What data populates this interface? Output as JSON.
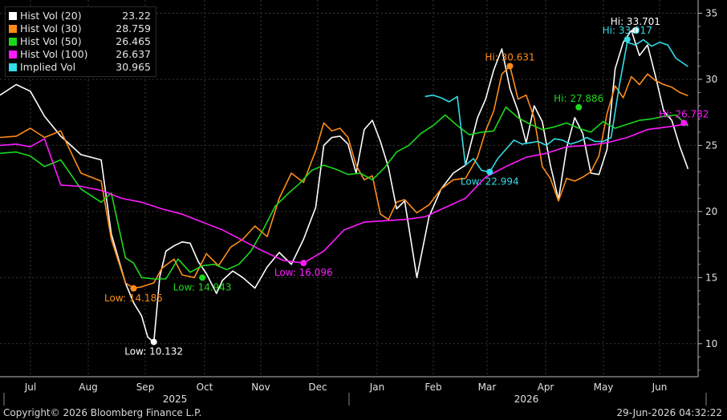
{
  "chart_data": {
    "type": "line",
    "xlabel": "",
    "ylabel": "",
    "ylim": [
      7.5,
      36
    ],
    "yticks": [
      10,
      15,
      20,
      25,
      30,
      35
    ],
    "grid": true,
    "legend_position": "top-left",
    "month_labels": [
      "Jul",
      "Aug",
      "Sep",
      "Oct",
      "Nov",
      "Dec",
      "Jan",
      "Feb",
      "Mar",
      "Apr",
      "May",
      "Jun"
    ],
    "year_labels": [
      "2025",
      "2026"
    ],
    "series": [
      {
        "name": "Hist Vol (20)",
        "last": "23.22",
        "color": "#ffffff",
        "x": [
          0,
          8,
          15,
          22,
          30,
          40,
          50,
          55,
          62,
          66,
          70,
          73,
          76,
          79,
          82,
          86,
          90,
          94,
          98,
          102,
          107,
          110,
          115,
          120,
          126,
          132,
          138,
          144,
          150,
          156,
          160,
          164,
          168,
          172,
          176,
          180,
          184,
          188,
          192,
          196,
          200,
          206,
          212,
          218,
          224,
          230,
          236,
          240,
          244,
          248,
          252,
          256,
          260,
          264,
          268,
          272,
          276,
          280,
          284,
          288,
          292,
          296,
          300,
          304,
          308,
          312,
          316,
          320,
          324,
          328,
          332,
          336,
          340
        ],
        "y": [
          28.8,
          29.6,
          29.1,
          27.2,
          25.7,
          24.3,
          23.9,
          18.3,
          14.6,
          13.1,
          12.1,
          10.5,
          10.1,
          15.1,
          17.0,
          17.4,
          17.7,
          17.6,
          16.2,
          15.3,
          13.8,
          14.8,
          15.5,
          15.0,
          14.2,
          15.8,
          16.9,
          16.0,
          17.9,
          20.3,
          25.0,
          25.6,
          25.7,
          25.1,
          22.9,
          26.2,
          26.9,
          25.3,
          23.3,
          20.2,
          20.8,
          15.0,
          19.6,
          21.7,
          22.9,
          23.5,
          27.1,
          28.5,
          30.7,
          32.3,
          29.3,
          27.6,
          25.2,
          28.0,
          26.8,
          23.5,
          20.9,
          24.8,
          27.1,
          25.9,
          22.9,
          22.8,
          24.7,
          30.8,
          32.8,
          33.7,
          31.8,
          32.6,
          30.2,
          27.6,
          26.9,
          24.9,
          23.22
        ]
      },
      {
        "name": "Hist Vol (30)",
        "last": "28.759",
        "color": "#ff8c1a",
        "x": [
          0,
          8,
          15,
          22,
          30,
          40,
          50,
          55,
          62,
          66,
          70,
          76,
          80,
          86,
          90,
          96,
          102,
          108,
          114,
          120,
          126,
          132,
          138,
          144,
          150,
          156,
          160,
          164,
          168,
          172,
          176,
          180,
          184,
          188,
          192,
          196,
          200,
          206,
          212,
          218,
          224,
          230,
          236,
          240,
          244,
          248,
          252,
          256,
          260,
          264,
          268,
          272,
          276,
          280,
          284,
          288,
          292,
          296,
          300,
          304,
          308,
          312,
          316,
          320,
          324,
          328,
          332,
          336,
          340
        ],
        "y": [
          25.6,
          25.7,
          26.3,
          25.6,
          26.1,
          22.9,
          22.3,
          17.9,
          14.6,
          14.2,
          14.3,
          14.6,
          15.7,
          16.4,
          15.2,
          15.0,
          16.8,
          15.9,
          17.3,
          17.9,
          18.9,
          18.1,
          21.0,
          22.9,
          22.2,
          24.6,
          26.7,
          26.1,
          26.3,
          25.6,
          23.5,
          22.4,
          22.7,
          19.8,
          19.4,
          20.7,
          20.9,
          19.9,
          20.5,
          21.7,
          22.4,
          22.5,
          24.1,
          26.1,
          27.6,
          30.4,
          31.0,
          28.5,
          28.8,
          27.1,
          23.4,
          22.5,
          20.8,
          22.5,
          22.3,
          22.6,
          23.0,
          24.2,
          27.4,
          29.5,
          28.6,
          30.2,
          29.6,
          30.4,
          29.9,
          29.6,
          29.4,
          29.0,
          28.759
        ]
      },
      {
        "name": "Hist Vol (50)",
        "last": "26.465",
        "color": "#1cd81c",
        "x": [
          0,
          8,
          15,
          22,
          30,
          40,
          50,
          55,
          62,
          66,
          70,
          76,
          82,
          88,
          94,
          100,
          106,
          112,
          118,
          124,
          130,
          136,
          142,
          148,
          154,
          160,
          166,
          172,
          178,
          184,
          190,
          196,
          202,
          208,
          214,
          220,
          226,
          232,
          238,
          244,
          250,
          256,
          262,
          268,
          274,
          280,
          286,
          292,
          298,
          304,
          310,
          316,
          322,
          328,
          334,
          340
        ],
        "y": [
          24.4,
          24.5,
          24.2,
          23.4,
          23.9,
          21.7,
          20.7,
          21.4,
          16.5,
          16.1,
          15.0,
          14.9,
          14.9,
          16.4,
          15.4,
          15.9,
          16.0,
          15.6,
          16.0,
          17.0,
          18.6,
          20.4,
          21.3,
          22.1,
          23.1,
          23.5,
          23.2,
          22.8,
          22.9,
          22.4,
          23.3,
          24.5,
          25.0,
          25.9,
          26.5,
          27.3,
          26.5,
          25.8,
          26.0,
          26.1,
          27.9,
          27.1,
          26.6,
          26.2,
          26.4,
          26.7,
          26.3,
          26.0,
          26.8,
          26.3,
          26.6,
          26.9,
          27.0,
          27.2,
          27.3,
          26.465
        ]
      },
      {
        "name": "Hist Vol (100)",
        "last": "26.637",
        "color": "#ff1cff",
        "x": [
          0,
          8,
          15,
          22,
          30,
          40,
          50,
          60,
          70,
          80,
          90,
          100,
          110,
          120,
          130,
          140,
          150,
          160,
          170,
          180,
          190,
          200,
          210,
          220,
          230,
          240,
          250,
          260,
          270,
          280,
          290,
          300,
          310,
          320,
          330,
          340
        ],
        "y": [
          25.0,
          25.1,
          24.9,
          25.5,
          22.0,
          21.9,
          21.6,
          21.0,
          20.7,
          20.2,
          19.8,
          19.2,
          18.6,
          17.8,
          17.0,
          16.3,
          16.1,
          17.0,
          18.6,
          19.2,
          19.3,
          19.4,
          19.6,
          20.3,
          21.0,
          22.6,
          23.4,
          24.1,
          24.4,
          24.9,
          25.0,
          25.2,
          25.6,
          26.2,
          26.4,
          26.637
        ]
      },
      {
        "name": "Implied Vol",
        "last": "30.965",
        "color": "#33dce8",
        "x": [
          210,
          214,
          218,
          222,
          226,
          230,
          234,
          238,
          242,
          246,
          250,
          254,
          258,
          262,
          266,
          270,
          274,
          278,
          282,
          286,
          290,
          294,
          298,
          302,
          306,
          310,
          314,
          318,
          322,
          326,
          330,
          334,
          340
        ],
        "y": [
          28.7,
          28.8,
          28.6,
          28.3,
          28.7,
          23.5,
          24.0,
          23.1,
          22.99,
          24.0,
          24.7,
          25.4,
          25.1,
          25.2,
          25.3,
          25.0,
          25.5,
          25.4,
          25.1,
          25.3,
          25.6,
          25.3,
          25.3,
          25.6,
          29.5,
          32.8,
          32.6,
          33.0,
          32.5,
          32.8,
          32.6,
          31.6,
          30.965
        ]
      }
    ],
    "annotations": [
      {
        "text": "Low: 10.132",
        "x": 76,
        "y": 10.132,
        "series": 0
      },
      {
        "text": "Hi: 33.701",
        "x": 314,
        "y": 33.701,
        "series": 0
      },
      {
        "text": "Low: 14.185",
        "x": 66,
        "y": 14.185,
        "series": 1
      },
      {
        "text": "Hi: 30.631",
        "x": 252,
        "y": 31.0,
        "series": 1
      },
      {
        "text": "Low: 14.943",
        "x": 100,
        "y": 15.0,
        "series": 2
      },
      {
        "text": "Hi: 27.886",
        "x": 286,
        "y": 27.886,
        "series": 2
      },
      {
        "text": "Low: 16.096",
        "x": 150,
        "y": 16.1,
        "series": 3
      },
      {
        "text": "Hi: 26.782",
        "x": 338,
        "y": 26.7,
        "series": 3
      },
      {
        "text": "Low: 22.994",
        "x": 242,
        "y": 22.994,
        "series": 4
      },
      {
        "text": "Hi: 33.017",
        "x": 310,
        "y": 33.017,
        "series": 4
      }
    ]
  },
  "legend": [
    {
      "name": "Hist Vol (20)",
      "value": "23.22",
      "color": "#ffffff"
    },
    {
      "name": "Hist Vol (30)",
      "value": "28.759",
      "color": "#ff8c1a"
    },
    {
      "name": "Hist Vol (50)",
      "value": "26.465",
      "color": "#1cd81c"
    },
    {
      "name": "Hist Vol (100)",
      "value": "26.637",
      "color": "#ff1cff"
    },
    {
      "name": "Implied Vol",
      "value": "30.965",
      "color": "#33dce8"
    }
  ],
  "footer": {
    "copyright": "Copyright© 2026 Bloomberg Finance L.P.",
    "timestamp": "29-Jun-2026 04:32:22"
  }
}
